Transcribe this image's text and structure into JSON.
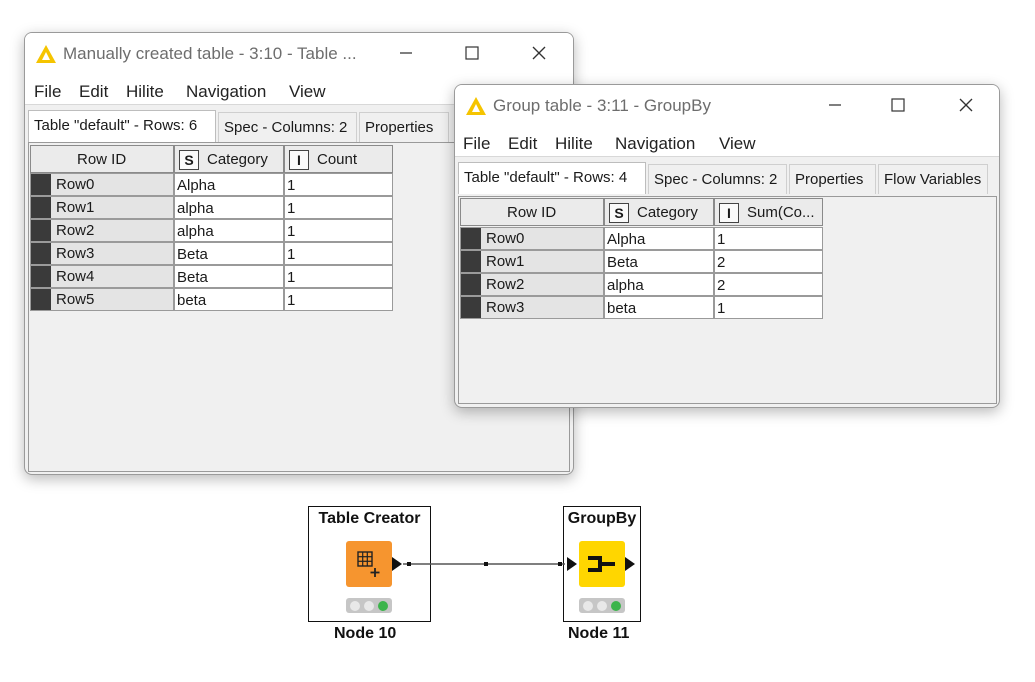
{
  "colors": {
    "knime_node_orange": "#f6952f",
    "knime_node_yellow": "#ffd600",
    "traffic_green": "#3cb44b",
    "row_marker": "#3a3a3a"
  },
  "window_manual": {
    "title": "Manually created table - 3:10 - Table ...",
    "icon": "knime-triangle-icon",
    "menu": [
      "File",
      "Edit",
      "Hilite",
      "Navigation",
      "View"
    ],
    "tabs": [
      "Table \"default\" - Rows: 6",
      "Spec - Columns: 2",
      "Properties"
    ],
    "columns": [
      "Row ID",
      "Category",
      "Count"
    ],
    "column_types": [
      "",
      "S",
      "I"
    ],
    "rows": [
      {
        "id": "Row0",
        "category": "Alpha",
        "count": "1"
      },
      {
        "id": "Row1",
        "category": "alpha",
        "count": "1"
      },
      {
        "id": "Row2",
        "category": "alpha",
        "count": "1"
      },
      {
        "id": "Row3",
        "category": "Beta",
        "count": "1"
      },
      {
        "id": "Row4",
        "category": "Beta",
        "count": "1"
      },
      {
        "id": "Row5",
        "category": "beta",
        "count": "1"
      }
    ]
  },
  "window_group": {
    "title": "Group table - 3:11 - GroupBy",
    "icon": "knime-triangle-icon",
    "menu": [
      "File",
      "Edit",
      "Hilite",
      "Navigation",
      "View"
    ],
    "tabs": [
      "Table \"default\" - Rows: 4",
      "Spec - Columns: 2",
      "Properties",
      "Flow Variables"
    ],
    "columns": [
      "Row ID",
      "Category",
      "Sum(Co..."
    ],
    "column_types": [
      "",
      "S",
      "I"
    ],
    "rows": [
      {
        "id": "Row0",
        "category": "Alpha",
        "sum": "1"
      },
      {
        "id": "Row1",
        "category": "Beta",
        "sum": "2"
      },
      {
        "id": "Row2",
        "category": "alpha",
        "sum": "2"
      },
      {
        "id": "Row3",
        "category": "beta",
        "sum": "1"
      }
    ]
  },
  "workflow": {
    "node10": {
      "title": "Table Creator",
      "label": "Node 10",
      "icon": "table-creator-icon"
    },
    "node11": {
      "title": "GroupBy",
      "label": "Node 11",
      "icon": "groupby-icon"
    }
  }
}
